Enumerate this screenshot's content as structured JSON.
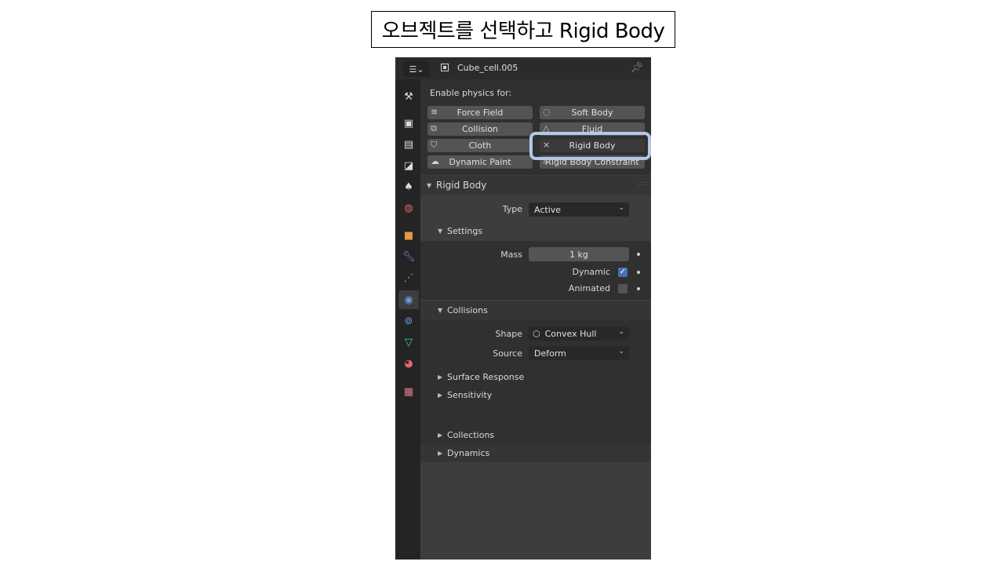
{
  "caption": "오브젝트를 선택하고 Rigid Body",
  "header": {
    "editor_icon": "properties-editor-icon",
    "object_icon": "object-icon",
    "object_name": "Cube_cell.005",
    "pin_icon": "pin-icon"
  },
  "tabs": [
    {
      "name": "tool",
      "icon": "tool-icon"
    },
    {
      "name": "render",
      "icon": "render-icon"
    },
    {
      "name": "output",
      "icon": "output-icon"
    },
    {
      "name": "view-layer",
      "icon": "view-layer-icon"
    },
    {
      "name": "scene",
      "icon": "scene-icon"
    },
    {
      "name": "world",
      "icon": "world-icon"
    },
    {
      "name": "object",
      "icon": "object-icon"
    },
    {
      "name": "modifiers",
      "icon": "wrench-icon"
    },
    {
      "name": "particles",
      "icon": "particles-icon"
    },
    {
      "name": "physics",
      "icon": "physics-icon",
      "active": true
    },
    {
      "name": "constraints",
      "icon": "constraints-icon"
    },
    {
      "name": "data",
      "icon": "mesh-data-icon"
    },
    {
      "name": "material",
      "icon": "material-icon"
    },
    {
      "name": "texture",
      "icon": "texture-icon"
    }
  ],
  "physics": {
    "enable_label": "Enable physics for:",
    "buttons": {
      "force_field": "Force Field",
      "soft_body": "Soft Body",
      "collision": "Collision",
      "fluid": "Fluid",
      "cloth": "Cloth",
      "rigid_body": "Rigid Body",
      "dynamic_paint": "Dynamic Paint",
      "rigid_body_constraint": "Rigid Body Constraint"
    },
    "rigid_body_remove_icon": "×"
  },
  "rigid_body": {
    "title": "Rigid Body",
    "type_label": "Type",
    "type_value": "Active",
    "settings": {
      "title": "Settings",
      "mass_label": "Mass",
      "mass_value": "1 kg",
      "dynamic_label": "Dynamic",
      "dynamic_checked": true,
      "animated_label": "Animated",
      "animated_checked": false
    },
    "collisions": {
      "title": "Collisions",
      "shape_label": "Shape",
      "shape_value": "Convex Hull",
      "source_label": "Source",
      "source_value": "Deform"
    },
    "collapsed_sections": [
      "Surface Response",
      "Sensitivity",
      "Collections",
      "Dynamics"
    ]
  },
  "colors": {
    "highlight": "#b4c7e7",
    "checkbox_on": "#4772b3"
  }
}
